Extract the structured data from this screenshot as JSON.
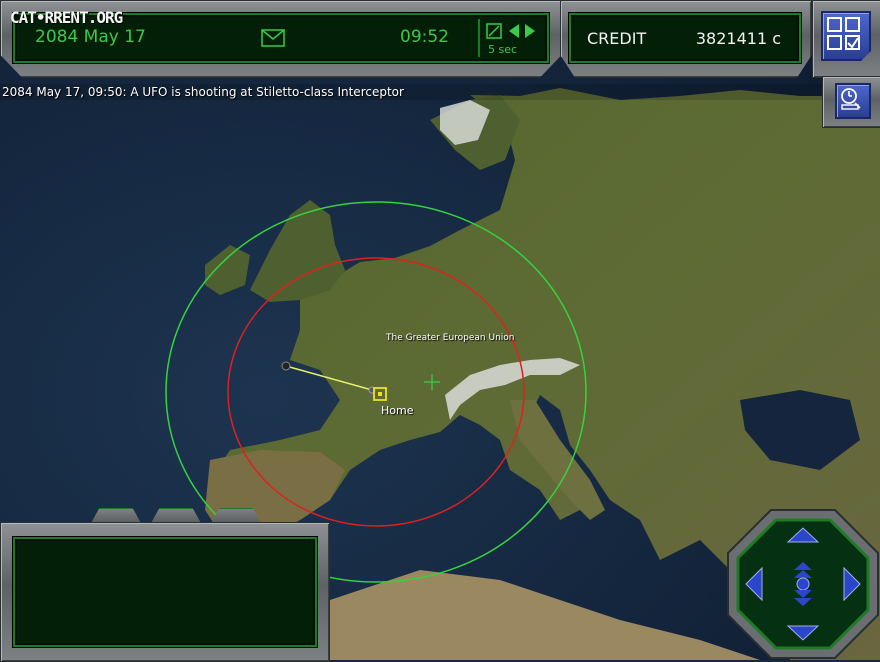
{
  "header": {
    "date": "2084 May 17",
    "time": "09:52",
    "speed": "5 sec",
    "mail_icon": "envelope-icon"
  },
  "credit": {
    "label": "CREDIT",
    "value": "3821411 c"
  },
  "status": {
    "message": "2084 May 17, 09:50: A UFO is shooting at Stiletto-class Interceptor"
  },
  "watermark": {
    "text": "CAT•RRENT.ORG"
  },
  "map": {
    "region_label": "The Greater European Union",
    "base_label": "Home"
  },
  "colors": {
    "screen_green": "#3dc94a",
    "radar_outer": "#35d23e",
    "radar_inner": "#e02020",
    "button_blue": "#3a51b4"
  },
  "icons": {
    "menu": "grid-checkbox-icon",
    "ufopaedia": "clock-book-icon",
    "nav_up": "arrow-up-icon",
    "nav_down": "arrow-down-icon",
    "nav_left": "arrow-left-icon",
    "nav_right": "arrow-right-icon"
  }
}
